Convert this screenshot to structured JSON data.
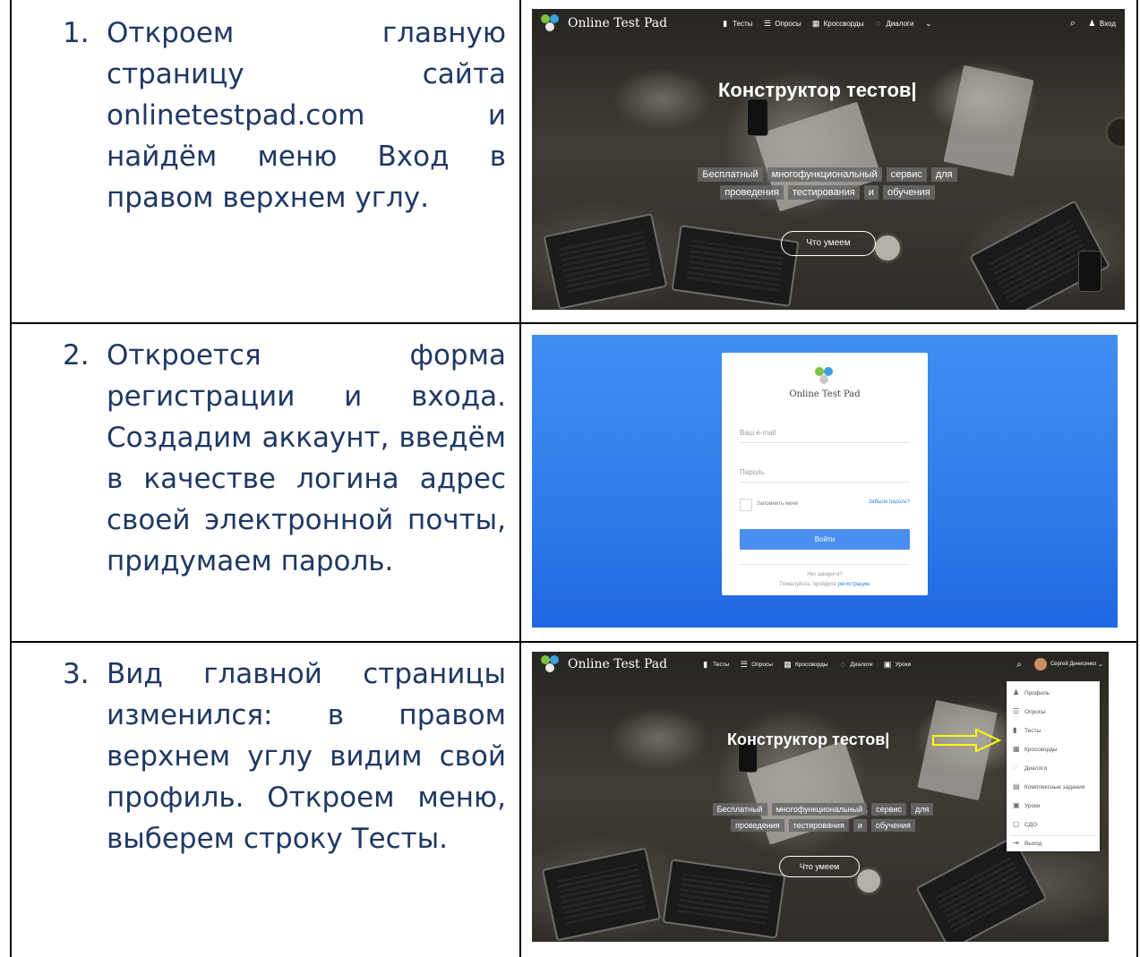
{
  "steps": [
    {
      "number": "1.",
      "text": "Откроем главную страницу сайта onlinetestpad.com и найдём меню Вход в правом верхнем углу."
    },
    {
      "number": "2.",
      "text": "Откроется форма регистрации и входа. Создадим аккаунт, введём в качестве логина адрес своей электронной почты, придумаем пароль."
    },
    {
      "number": "3.",
      "text": "Вид главной страницы изменился: в правом верхнем углу видим свой профиль. Откроем меню, выберем строку Тесты."
    }
  ],
  "screen1": {
    "brand": "Online Test Pad",
    "nav": [
      {
        "label": "Тесты",
        "icon": "test-icon"
      },
      {
        "label": "Опросы",
        "icon": "poll-icon"
      },
      {
        "label": "Кроссворды",
        "icon": "crossword-icon"
      },
      {
        "label": "Диалоги",
        "icon": "dialog-icon"
      }
    ],
    "more_icon": "chevron-down-icon",
    "search_icon": "search-icon",
    "login_label": "Вход",
    "hero_title": "Конструктор тестов|",
    "chips": [
      "Бесплатный",
      "многофункциональный",
      "сервис",
      "для",
      "проведения",
      "тестирования",
      "и",
      "обучения"
    ],
    "cta": "Что умеем"
  },
  "screen2": {
    "brand": "Online Test Pad",
    "email_placeholder": "Ваш e-mail",
    "password_placeholder": "Пароль",
    "remember": "Запомнить меня",
    "forgot": "Забыли пароль?",
    "submit": "Войти",
    "no_account": "Нет аккаунта?",
    "register_prefix": "Пожалуйста, пройдите",
    "register_link": "регистрацию"
  },
  "screen3": {
    "brand": "Online Test Pad",
    "nav": [
      {
        "label": "Тесты",
        "icon": "test-icon"
      },
      {
        "label": "Опросы",
        "icon": "poll-icon"
      },
      {
        "label": "Кроссворды",
        "icon": "crossword-icon"
      },
      {
        "label": "Диалоги",
        "icon": "dialog-icon"
      },
      {
        "label": "Уроки",
        "icon": "lesson-icon"
      }
    ],
    "user_name": "Сергей Денисенко",
    "hero_title": "Конструктор тестов|",
    "chips": [
      "Бесплатный",
      "многофункциональный",
      "сервис",
      "для",
      "проведения",
      "тестирования",
      "и",
      "обучения"
    ],
    "cta": "Что умеем",
    "menu": [
      {
        "label": "Профиль",
        "icon": "user-icon"
      },
      {
        "label": "Опросы",
        "icon": "poll-icon"
      },
      {
        "label": "Тесты",
        "icon": "test-icon"
      },
      {
        "label": "Кроссворды",
        "icon": "crossword-icon"
      },
      {
        "label": "Диалоги",
        "icon": "dialog-icon"
      },
      {
        "label": "Комплексные задания",
        "icon": "task-icon"
      },
      {
        "label": "Уроки",
        "icon": "lesson-icon"
      },
      {
        "label": "СДО",
        "icon": "lms-icon"
      },
      {
        "label": "Выход",
        "icon": "logout-icon"
      }
    ],
    "arrow_color": "#ffff00"
  },
  "colors": {
    "step_text": "#1f3864",
    "login_blue": "#3f8ff3",
    "link_blue": "#3a7fe0"
  }
}
